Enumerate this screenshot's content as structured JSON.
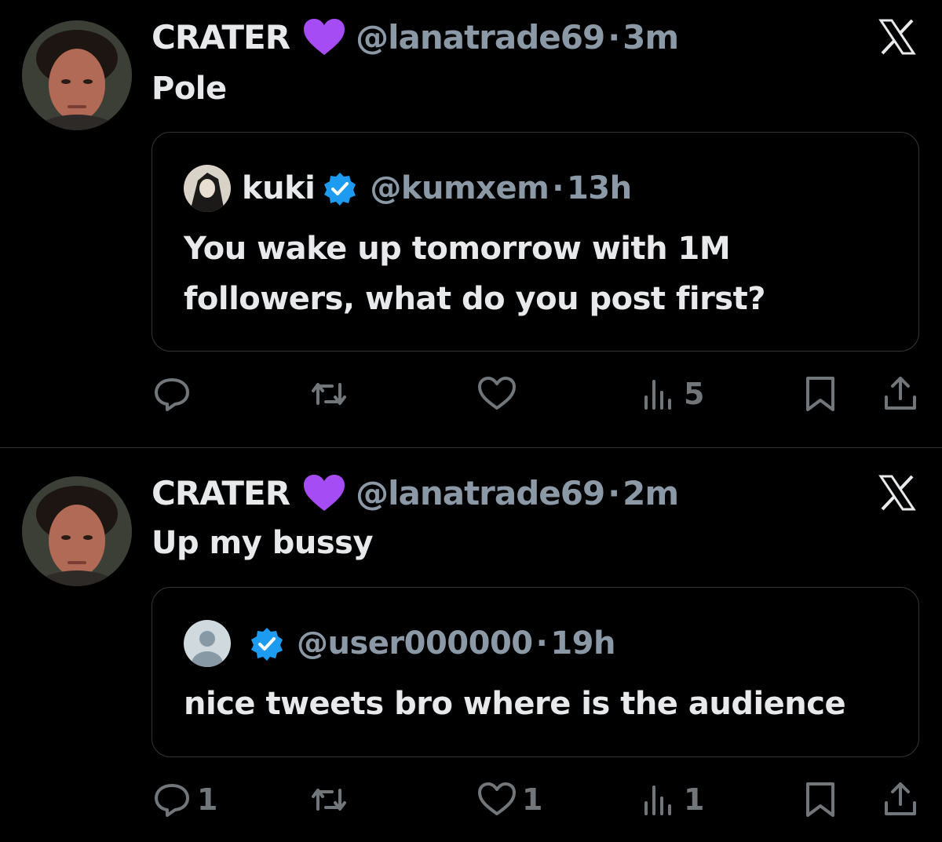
{
  "tweets": [
    {
      "author_name": "CRATER",
      "author_handle": "@lanatrade69",
      "dot": "·",
      "time": "3m",
      "text": "Pole",
      "quote": {
        "name": "kuki",
        "handle": "@kumxem",
        "dot": "·",
        "time": "13h",
        "lines": [
          "You wake up tomorrow with 1M",
          "followers, what do you post first?"
        ]
      },
      "actions": {
        "reply_count": "",
        "retweet_count": "",
        "like_count": "",
        "views_count": "5"
      }
    },
    {
      "author_name": "CRATER",
      "author_handle": "@lanatrade69",
      "dot": "·",
      "time": "2m",
      "text": "Up my bussy",
      "quote": {
        "name": "",
        "handle": "@user000000",
        "dot": "·",
        "time": "19h",
        "lines": [
          "nice tweets bro where is the audience"
        ]
      },
      "actions": {
        "reply_count": "1",
        "retweet_count": "",
        "like_count": "1",
        "views_count": "1"
      }
    }
  ],
  "icons": {
    "name_emoji": "purple-heart-icon",
    "verified": "verified-badge-icon",
    "close": "x-logo-icon"
  },
  "colors": {
    "background": "#000000",
    "text": "#e7e9ea",
    "secondary": "#8b98a5",
    "verified": "#1d9bf0",
    "heart": "#a64cf5"
  }
}
